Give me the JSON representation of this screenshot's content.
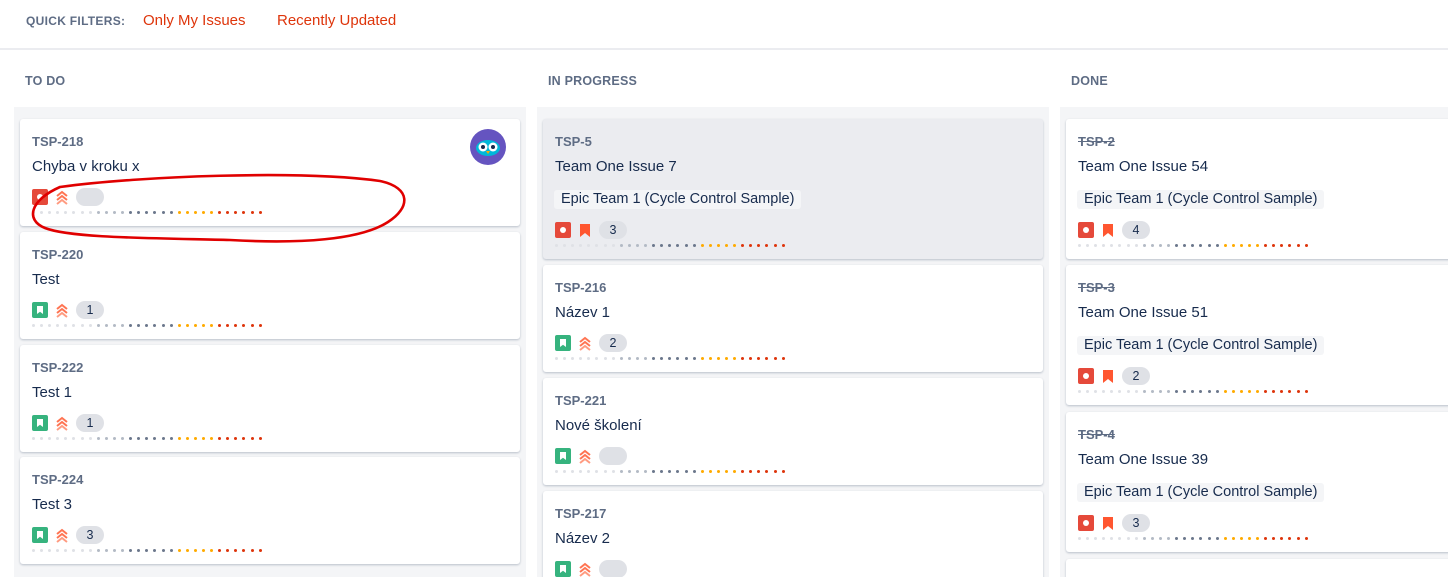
{
  "quick_filters": {
    "label": "QUICK FILTERS:",
    "items": [
      "Only My Issues",
      "Recently Updated"
    ]
  },
  "columns": [
    {
      "title": "TO DO",
      "cards": [
        {
          "key": "TSP-218",
          "summary": "Chyba v kroku x",
          "type": "bug-icon",
          "priority": "highest-priority-icon",
          "estimate": "",
          "avatar": true
        },
        {
          "key": "TSP-220",
          "summary": "Test",
          "type": "story-icon",
          "priority": "highest-priority-icon",
          "estimate": "1"
        },
        {
          "key": "TSP-222",
          "summary": "Test 1",
          "type": "story-icon",
          "priority": "highest-priority-icon",
          "estimate": "1"
        },
        {
          "key": "TSP-224",
          "summary": "Test 3",
          "type": "story-icon",
          "priority": "highest-priority-icon",
          "estimate": "3"
        }
      ]
    },
    {
      "title": "IN PROGRESS",
      "cards": [
        {
          "key": "TSP-5",
          "summary": "Team One Issue 7",
          "epic": "Epic Team 1 (Cycle Control Sample)",
          "type": "bug-icon",
          "priority": "high-priority-icon",
          "estimate": "3",
          "selected": true
        },
        {
          "key": "TSP-216",
          "summary": "Název 1",
          "type": "story-icon",
          "priority": "highest-priority-icon",
          "estimate": "2"
        },
        {
          "key": "TSP-221",
          "summary": "Nové školení",
          "type": "story-icon",
          "priority": "highest-priority-icon",
          "estimate": ""
        },
        {
          "key": "TSP-217",
          "summary": "Název 2",
          "type": "story-icon",
          "priority": "highest-priority-icon",
          "estimate": ""
        }
      ]
    },
    {
      "title": "DONE",
      "cards": [
        {
          "key": "TSP-2",
          "summary": "Team One Issue 54",
          "epic": "Epic Team 1 (Cycle Control Sample)",
          "type": "bug-icon",
          "priority": "high-priority-icon",
          "estimate": "4"
        },
        {
          "key": "TSP-3",
          "summary": "Team One Issue 51",
          "epic": "Epic Team 1 (Cycle Control Sample)",
          "type": "bug-icon",
          "priority": "high-priority-icon",
          "estimate": "2"
        },
        {
          "key": "TSP-4",
          "summary": "Team One Issue 39",
          "epic": "Epic Team 1 (Cycle Control Sample)",
          "type": "bug-icon",
          "priority": "high-priority-icon",
          "estimate": "3"
        }
      ]
    }
  ],
  "colors": {
    "accent_link": "#de350b",
    "bug": "#e5493a",
    "story": "#36b37e",
    "priority": "#ff7452",
    "annotation": "#e00000"
  }
}
